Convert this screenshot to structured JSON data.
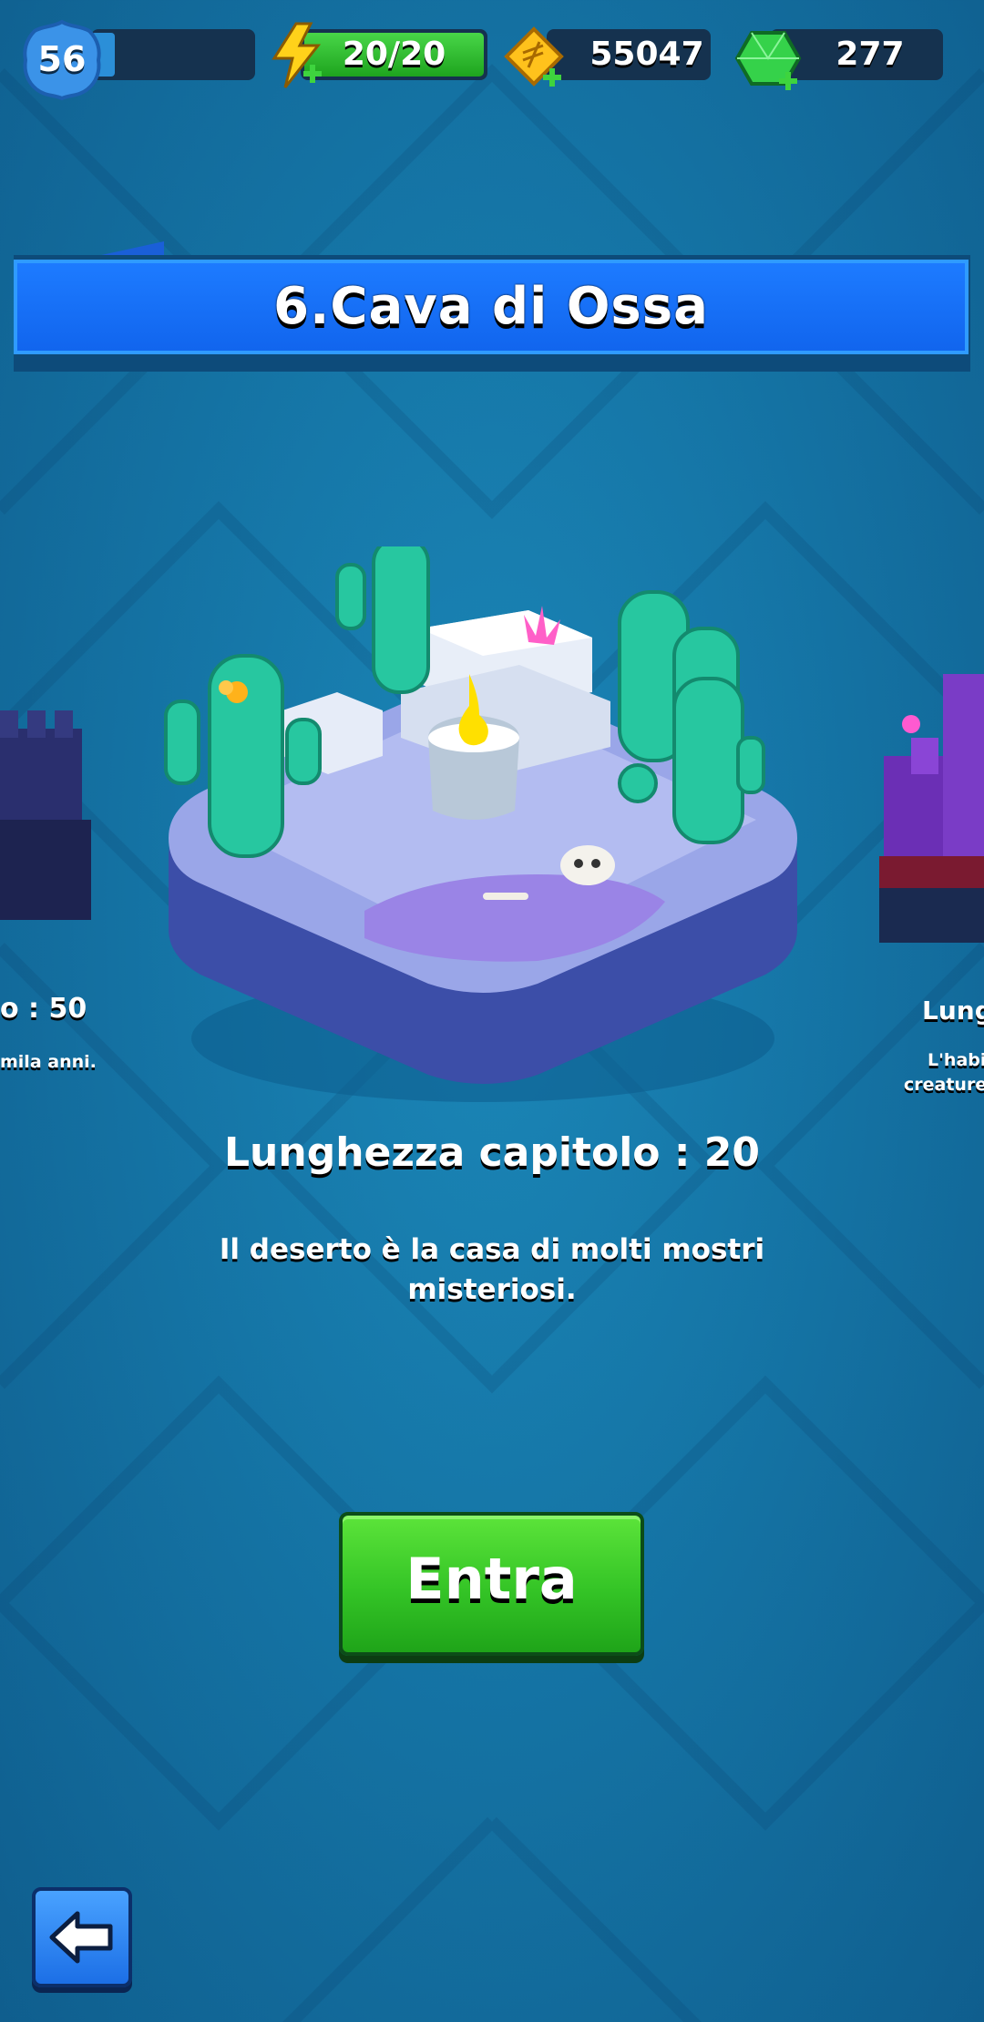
{
  "header": {
    "level": "56",
    "energy": "20/20",
    "gold": "55047",
    "gems": "277"
  },
  "stage": {
    "title": "6.Cava di Ossa",
    "chapter_length": "Lunghezza capitolo : 20",
    "description": "Il deserto è la casa di molti mostri misteriosi."
  },
  "prev_stage": {
    "length_fragment": "o : 50",
    "desc_fragment": "mila anni."
  },
  "next_stage": {
    "length_fragment": "Lungh",
    "desc_line1": "L'habit",
    "desc_line2": "creature c"
  },
  "buttons": {
    "enter": "Entra"
  },
  "colors": {
    "background": "#1575a6",
    "title_banner": "#1d7bff",
    "enter_button": "#34c426"
  }
}
